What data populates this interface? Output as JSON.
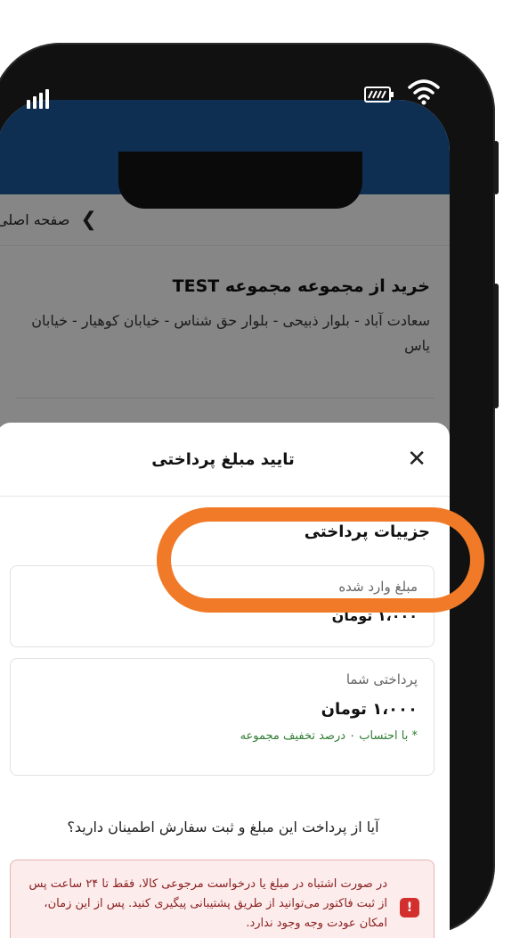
{
  "nav": {
    "back_icon": "chevron-right-icon",
    "home_label": "صفحه اصلی"
  },
  "store": {
    "title": "خرید از مجموعه مجموعه TEST",
    "address": "سعادت آباد - بلوار ذبیحی - بلوار حق شناس - خیابان کوهیار - خیابان یاس"
  },
  "sheet": {
    "title": "تایید مبلغ پرداختی",
    "close_icon": "close-icon",
    "details_heading": "جزییات پرداختی",
    "entered_amount": {
      "label": "مبلغ وارد شده",
      "value": "۱،۰۰۰ تومان"
    },
    "your_payment": {
      "label": "پرداختی شما",
      "value": "۱،۰۰۰ تومان",
      "note": "* با احتساب ۰ درصد تخفیف مجموعه"
    },
    "question": "آیا از پرداخت این مبلغ و ثبت سفارش اطمینان دارید؟",
    "alert": {
      "icon": "alert-icon",
      "text": "در صورت اشتباه در مبلغ یا درخواست مرجوعی کالا، فقط تا ۲۴ ساعت پس از ثبت فاکتور می‌توانید از طریق پشتیبانی پیگیری کنید. پس از این زمان، امکان عودت وجه وجود ندارد."
    }
  },
  "colors": {
    "statusbar": "#0e2e52",
    "highlight": "#f07a27",
    "alert_bg": "#fdecec",
    "note_green": "#2e7d32"
  }
}
